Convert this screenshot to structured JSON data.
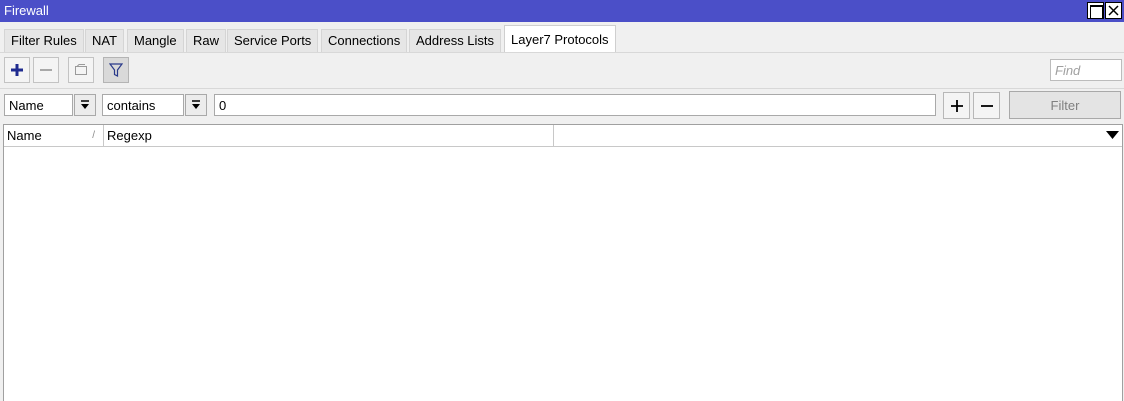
{
  "window": {
    "title": "Firewall"
  },
  "tabs": [
    {
      "label": "Filter Rules"
    },
    {
      "label": "NAT"
    },
    {
      "label": "Mangle"
    },
    {
      "label": "Raw"
    },
    {
      "label": "Service Ports"
    },
    {
      "label": "Connections"
    },
    {
      "label": "Address Lists"
    },
    {
      "label": "Layer7 Protocols",
      "active": true
    }
  ],
  "toolbar": {
    "add_icon": "plus-icon",
    "remove_icon": "minus-icon",
    "comment_icon": "comment-icon",
    "filter_icon": "funnel-icon",
    "find_placeholder": "Find"
  },
  "filter": {
    "field": "Name",
    "operator": "contains",
    "value": "0",
    "apply_label": "Filter"
  },
  "table": {
    "columns": [
      {
        "label": "Name"
      },
      {
        "label": "Regexp"
      },
      {
        "label": ""
      }
    ],
    "rows": []
  },
  "colors": {
    "titlebar": "#4b4fc8",
    "accent_icon": "#1f2b8f"
  }
}
